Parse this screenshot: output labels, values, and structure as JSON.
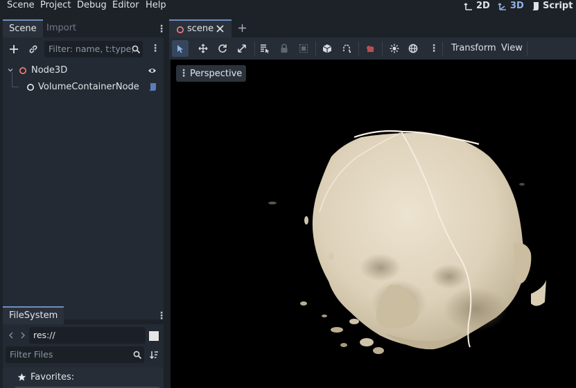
{
  "menubar": {
    "items": [
      "Scene",
      "Project",
      "Debug",
      "Editor",
      "Help"
    ],
    "workspaces": [
      {
        "label": "2D",
        "icon": "2d-icon"
      },
      {
        "label": "3D",
        "icon": "3d-icon"
      },
      {
        "label": "Script",
        "icon": "script-icon"
      }
    ]
  },
  "scene_dock": {
    "tabs": [
      "Scene",
      "Import"
    ],
    "filter_placeholder": "Filter: name, t:type,",
    "tree": [
      {
        "label": "Node3D",
        "icon": "node3d-icon",
        "badge": "visibility-eye-icon"
      },
      {
        "label": "VolumeContainerNode",
        "icon": "node3d-icon",
        "badge": "attached-script-icon"
      }
    ]
  },
  "filesystem_dock": {
    "tab": "FileSystem",
    "path": "res://",
    "filter_placeholder": "Filter Files",
    "favorites_label": "Favorites:"
  },
  "editor": {
    "scene_tab_label": "scene",
    "toolbar": {
      "transform_menu": "Transform",
      "view_menu": "View"
    },
    "viewport": {
      "perspective_label": "Perspective",
      "content": "volume-rendered-head"
    }
  },
  "colors": {
    "accent": "#6d8fbf",
    "workspace_active": "#8fb2e8",
    "node3d_icon": "#fc7f7f",
    "background": "#1d2229",
    "panel": "#232a33",
    "viewport_bg": "#000000",
    "volume": "#e3d8c3"
  }
}
